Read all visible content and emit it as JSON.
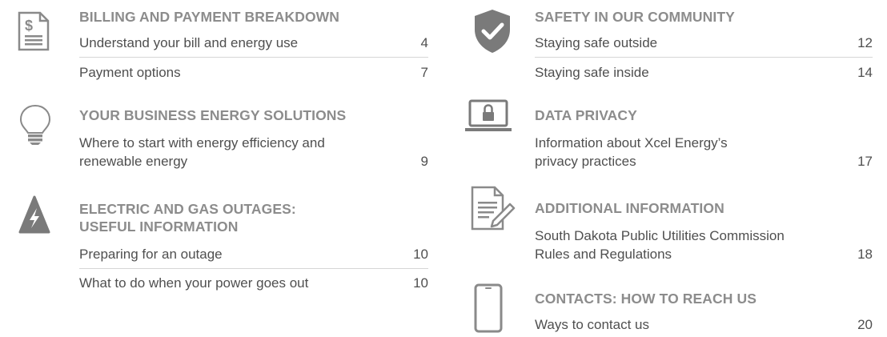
{
  "left": [
    {
      "icon": "bill-icon",
      "heading": "BILLING AND PAYMENT BREAKDOWN",
      "entries": [
        {
          "label": "Understand your bill and energy use",
          "page": "4"
        },
        {
          "label": "Payment options",
          "page": "7"
        }
      ]
    },
    {
      "icon": "lightbulb-icon",
      "heading": "YOUR BUSINESS ENERGY SOLUTIONS",
      "entries": [
        {
          "label": "Where to start with energy efficiency and\nrenewable energy",
          "page": "9"
        }
      ]
    },
    {
      "icon": "lightning-icon",
      "heading": "ELECTRIC AND GAS OUTAGES:\nUSEFUL INFORMATION",
      "entries": [
        {
          "label": "Preparing for an outage",
          "page": "10"
        },
        {
          "label": "What to do when your power goes out",
          "page": "10"
        }
      ]
    }
  ],
  "right": [
    {
      "icon": "shield-check-icon",
      "heading": "SAFETY IN OUR COMMUNITY",
      "entries": [
        {
          "label": "Staying safe outside",
          "page": "12"
        },
        {
          "label": "Staying safe inside",
          "page": "14"
        }
      ]
    },
    {
      "icon": "laptop-lock-icon",
      "heading": "DATA PRIVACY",
      "entries": [
        {
          "label": "Information about Xcel Energy’s\nprivacy practices",
          "page": "17"
        }
      ]
    },
    {
      "icon": "document-pen-icon",
      "heading": "ADDITIONAL INFORMATION",
      "entries": [
        {
          "label": "South Dakota Public Utilities Commission\nRules and Regulations",
          "page": "18"
        }
      ]
    },
    {
      "icon": "phone-icon",
      "heading": "CONTACTS: HOW TO REACH US",
      "entries": [
        {
          "label": "Ways to contact us",
          "page": "20"
        }
      ]
    }
  ]
}
